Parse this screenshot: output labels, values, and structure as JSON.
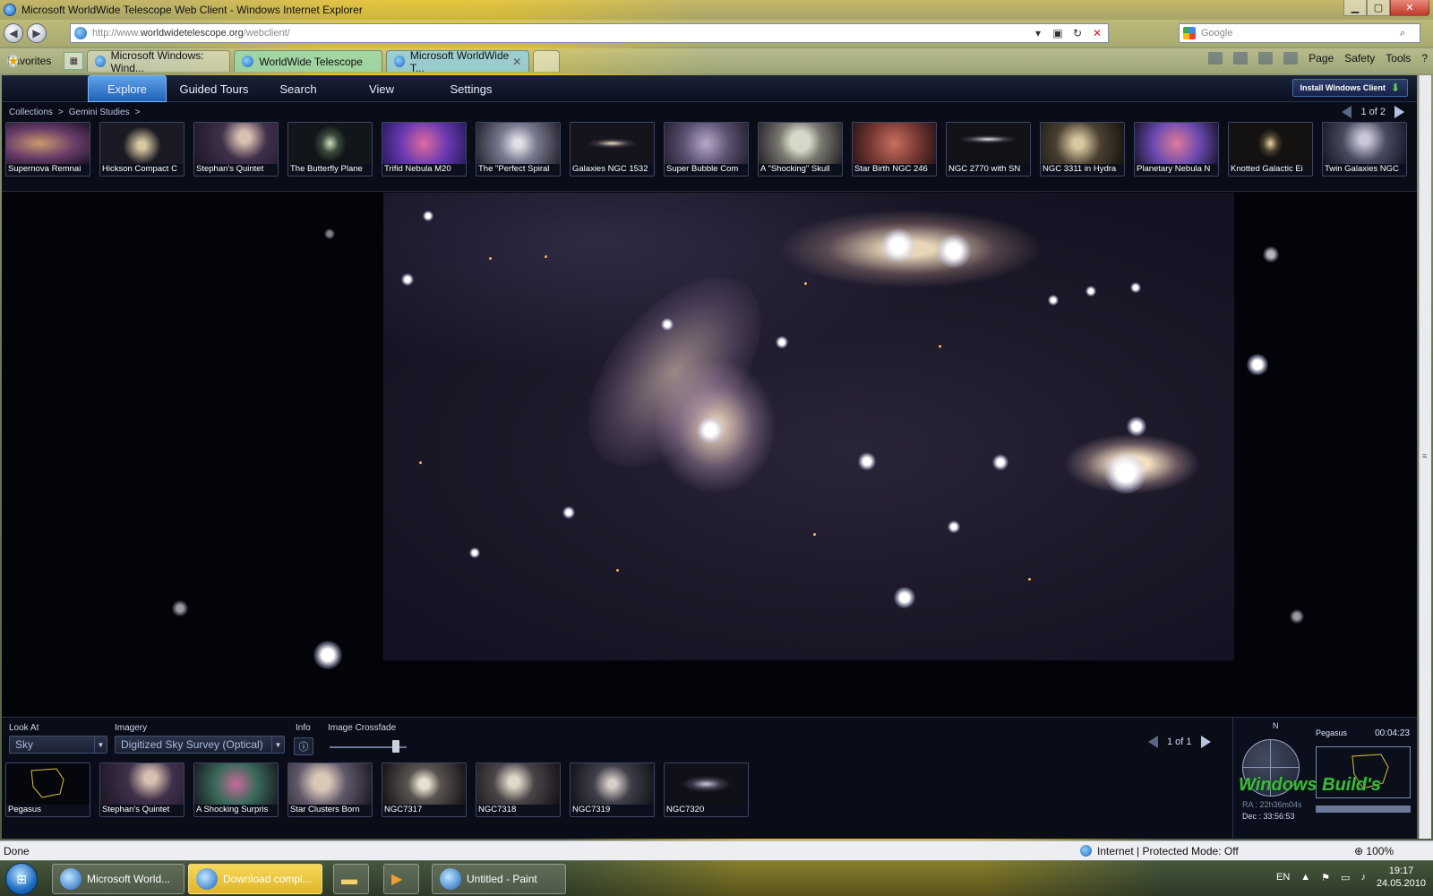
{
  "window": {
    "title": "Microsoft WorldWide Telescope Web Client - Windows Internet Explorer"
  },
  "address": {
    "url_prefix": "http://www.",
    "url_domain": "worldwidetelescope.org",
    "url_path": "/webclient/"
  },
  "search": {
    "placeholder": "Google"
  },
  "toolbar": {
    "favorites": "Favorites",
    "tabs": [
      {
        "label": "Microsoft Windows: Wind..."
      },
      {
        "label": "WorldWide Telescope"
      },
      {
        "label": "Microsoft WorldWide T..."
      }
    ],
    "commands": [
      "Page",
      "Safety",
      "Tools"
    ]
  },
  "wwt": {
    "nav": [
      "Explore",
      "Guided Tours",
      "Search",
      "View",
      "Settings"
    ],
    "install": {
      "text": "Install Windows Client"
    },
    "breadcrumb": {
      "collections": "Collections",
      "sep1": ">",
      "gemini": "Gemini Studies",
      "sep2": ">"
    },
    "pager": "1 of 2",
    "collection_thumbs": [
      {
        "label": "Supernova Remnai"
      },
      {
        "label": "Hickson Compact C"
      },
      {
        "label": "Stephan's Quintet"
      },
      {
        "label": "The Butterfly Plane"
      },
      {
        "label": "Trifid Nebula M20"
      },
      {
        "label": "The \"Perfect Spiral"
      },
      {
        "label": "Galaxies NGC 1532"
      },
      {
        "label": "Super Bubble Com"
      },
      {
        "label": "A \"Shocking\" Skull"
      },
      {
        "label": "Star Birth NGC 246"
      },
      {
        "label": "NGC 2770 with SN"
      },
      {
        "label": "NGC 3311 in Hydra"
      },
      {
        "label": "Planetary Nebula N"
      },
      {
        "label": "Knotted Galactic Ei"
      },
      {
        "label": "Twin Galaxies NGC"
      }
    ],
    "bottom": {
      "look_at_label": "Look At",
      "look_at_value": "Sky",
      "imagery_label": "Imagery",
      "imagery_value": "Digitized Sky Survey (Optical)",
      "info_label": "Info",
      "crossfade_label": "Image Crossfade",
      "crossfade_value": 0.9,
      "pager": "1 of 1",
      "thumbs": [
        {
          "label": "Pegasus"
        },
        {
          "label": "Stephan's Quintet"
        },
        {
          "label": "A Shocking Surpris"
        },
        {
          "label": "Star Clusters Born"
        },
        {
          "label": "NGC7317"
        },
        {
          "label": "NGC7318"
        },
        {
          "label": "NGC7319"
        },
        {
          "label": "NGC7320"
        }
      ]
    },
    "minimap": {
      "north": "N",
      "constellation": "Pegasus",
      "time": "00:04:23",
      "ra": "RA : 22h36m04s",
      "dec": "Dec : 33:56:53",
      "watermark": "Windows Build's"
    }
  },
  "status": {
    "left": "Done",
    "zone": "Internet | Protected Mode: Off",
    "zoom": "100%"
  },
  "taskbar": {
    "items": [
      "Microsoft World...",
      "Download compl...",
      "Untitled - Paint"
    ],
    "lang": "EN",
    "time": "19:17",
    "date": "24.05.2010"
  }
}
